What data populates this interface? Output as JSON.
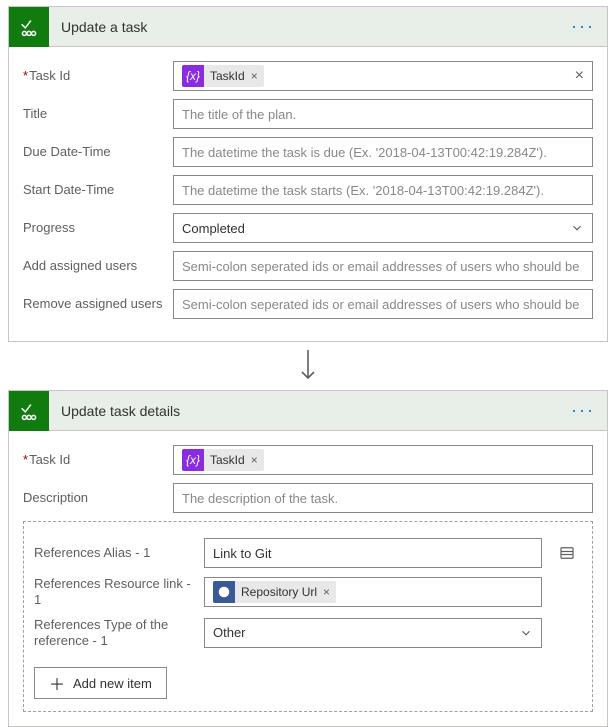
{
  "card1": {
    "title": "Update a task",
    "taskId": {
      "label": "Task Id",
      "token": "TaskId"
    },
    "title_field": {
      "label": "Title",
      "placeholder": "The title of the plan."
    },
    "due": {
      "label": "Due Date-Time",
      "placeholder": "The datetime the task is due (Ex. '2018-04-13T00:42:19.284Z')."
    },
    "start": {
      "label": "Start Date-Time",
      "placeholder": "The datetime the task starts (Ex. '2018-04-13T00:42:19.284Z')."
    },
    "progress": {
      "label": "Progress",
      "value": "Completed"
    },
    "addUsers": {
      "label": "Add assigned users",
      "placeholder": "Semi-colon seperated ids or email addresses of users who should be"
    },
    "removeUsers": {
      "label": "Remove assigned users",
      "placeholder": "Semi-colon seperated ids or email addresses of users who should be"
    }
  },
  "card2": {
    "title": "Update task details",
    "taskId": {
      "label": "Task Id",
      "token": "TaskId"
    },
    "description": {
      "label": "Description",
      "placeholder": "The description of the task."
    },
    "refAlias": {
      "label": "References Alias - 1",
      "value": "Link to Git"
    },
    "refLink": {
      "label": "References Resource link - 1",
      "token": "Repository Url"
    },
    "refType": {
      "label": "References Type of the reference - 1",
      "value": "Other"
    },
    "addItem": "Add new item"
  },
  "tokenGlyph": "{x}"
}
